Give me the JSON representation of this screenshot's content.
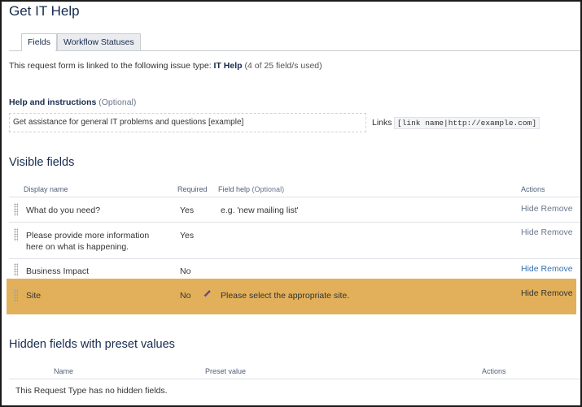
{
  "page": {
    "title": "Get IT Help"
  },
  "tabs": [
    {
      "label": "Fields"
    },
    {
      "label": "Workflow Statuses"
    }
  ],
  "linked": {
    "prefix": "This request form is linked to the following issue type:",
    "issue_type": "IT Help",
    "count": "(4 of 25 field/s used)"
  },
  "help": {
    "label": "Help and instructions",
    "optional": "(Optional)",
    "value": "Get assistance for general IT problems and questions [example]",
    "links_label": "Links",
    "links_syntax": "[link name|http://example.com]"
  },
  "visible_fields": {
    "title": "Visible fields",
    "columns": {
      "display_name": "Display name",
      "required": "Required",
      "field_help": "Field help",
      "field_help_optional": "(Optional)",
      "actions": "Actions"
    },
    "rows": [
      {
        "name": "What do you need?",
        "required": "Yes",
        "help": "e.g. 'new mailing list'",
        "hide": "Hide",
        "remove": "Remove"
      },
      {
        "name": "Please provide more information here on what is happening.",
        "required": "Yes",
        "help": "",
        "hide": "Hide",
        "remove": "Remove"
      },
      {
        "name": "Business Impact",
        "required": "No",
        "help": "",
        "hide": "Hide",
        "remove": "Remove"
      },
      {
        "name": "Site",
        "required": "No",
        "help": "Please select the appropriate site.",
        "hide": "Hide",
        "remove": "Remove"
      }
    ]
  },
  "hidden_fields": {
    "title": "Hidden fields with preset values",
    "columns": {
      "name": "Name",
      "preset": "Preset value",
      "actions": "Actions"
    },
    "empty_text": "This Request Type has no hidden fields."
  },
  "colors": {
    "highlight": "#e2b05a",
    "link": "#3572b0",
    "heading": "#172b4d"
  },
  "icons": {
    "edit": "pencil-icon",
    "drag": "drag-handle-icon"
  }
}
